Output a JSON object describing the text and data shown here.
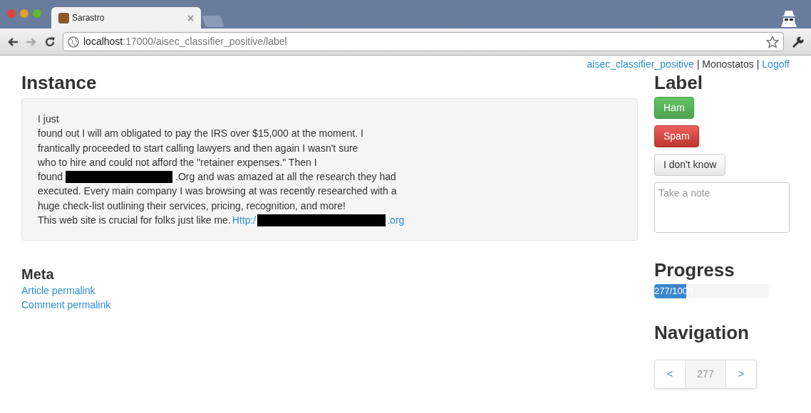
{
  "browser": {
    "tab": {
      "title": "Sarastro",
      "selected": true
    },
    "address": {
      "host": "localhost",
      "path": ":17000/aisec_classifier_positive/label"
    }
  },
  "user_bar": [
    {
      "kind": "link",
      "text": "aisec_classifier_positive"
    },
    {
      "kind": "separator",
      "text": "|"
    },
    {
      "kind": "text",
      "text": "Monostatos"
    },
    {
      "kind": "separator",
      "text": "|"
    },
    {
      "kind": "link",
      "text": "Logoff"
    }
  ],
  "instance": {
    "title": "Instance",
    "lines": [
      [
        {
          "kind": "text",
          "text": "I just"
        }
      ],
      [
        {
          "kind": "text",
          "text": "found out I will am obligated to pay the IRS over $15,000 at the moment. I"
        }
      ],
      [
        {
          "kind": "text",
          "text": "frantically proceeded to start calling lawyers and then again I wasn't sure"
        }
      ],
      [
        {
          "kind": "text",
          "text": "who to hire and could not afford the \"retainer expenses.\" Then I"
        }
      ],
      [
        {
          "kind": "text",
          "text": "found"
        },
        {
          "kind": "redaction"
        },
        {
          "kind": "text",
          "text": ".Org and was amazed at all the research they had"
        }
      ],
      [
        {
          "kind": "text",
          "text": "executed. Every main company I was browsing at was recently researched with a"
        }
      ],
      [
        {
          "kind": "text",
          "text": "huge check-list outlining their services, pricing, recognition, and more!"
        }
      ],
      [
        {
          "kind": "text",
          "text": "This web site is crucial for folks just like me."
        },
        {
          "kind": "link",
          "text": "Http:/"
        },
        {
          "kind": "redaction"
        },
        {
          "kind": "link",
          "text": ".org"
        }
      ]
    ]
  },
  "meta": {
    "title": "Meta",
    "links": [
      "Article permalink",
      "Comment permalink"
    ]
  },
  "label": {
    "title": "Label",
    "buttons": [
      {
        "kind": "success",
        "text": "Ham"
      },
      {
        "kind": "danger",
        "text": "Spam"
      },
      {
        "kind": "default",
        "text": "I don't know"
      }
    ],
    "note": {
      "placeholder": "Take a note"
    }
  },
  "progress": {
    "title": "Progress",
    "level": 0.277,
    "text": "277/1000"
  },
  "navigation": {
    "title": "Navigation",
    "prev": "<",
    "current": "277",
    "next": ">"
  }
}
